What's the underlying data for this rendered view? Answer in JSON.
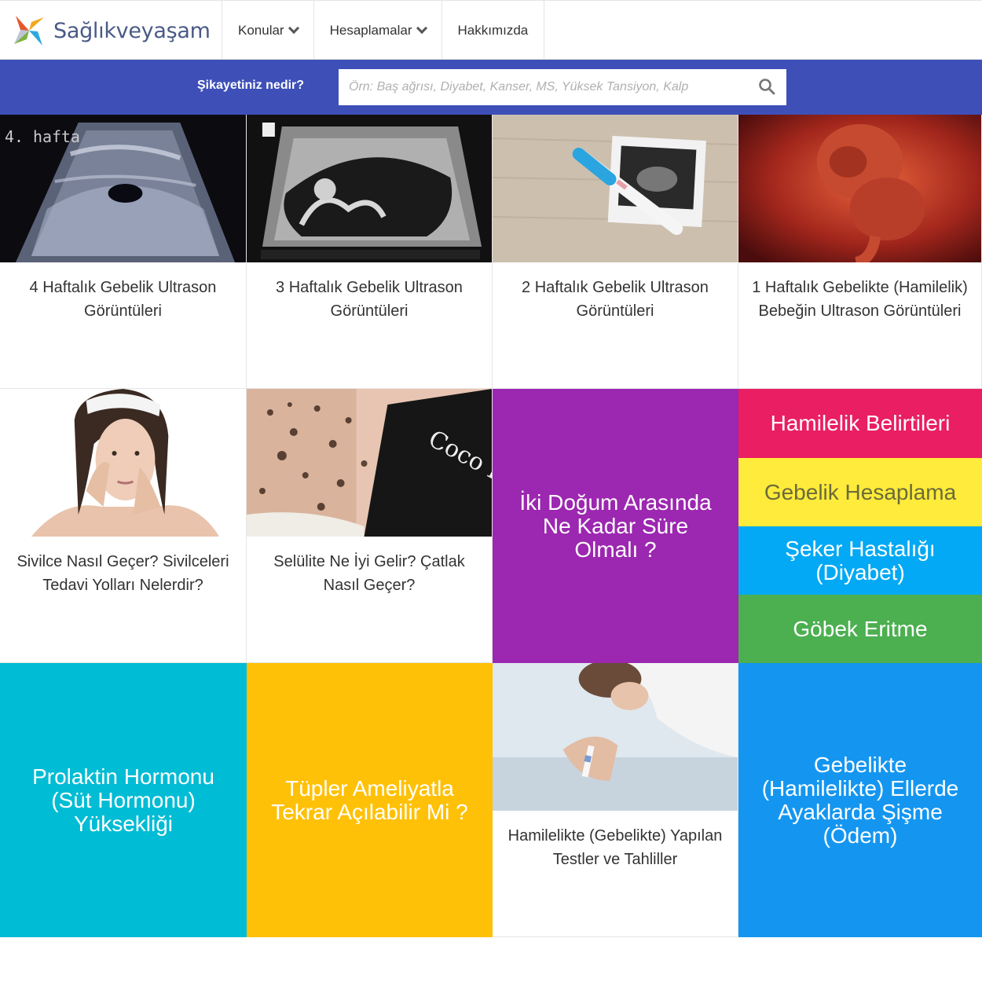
{
  "header": {
    "logo_text": "Sağlıkveyaşam",
    "nav": [
      {
        "label": "Konular",
        "has_dropdown": true
      },
      {
        "label": "Hesaplamalar",
        "has_dropdown": true
      },
      {
        "label": "Hakkımızda",
        "has_dropdown": false
      }
    ]
  },
  "search": {
    "label": "Şikayetiniz nedir?",
    "placeholder": "Örn: Baş ağrısı, Diyabet, Kanser, MS, Yüksek Tansiyon, Kalp",
    "value": "",
    "icon": "search-icon"
  },
  "cards": [
    {
      "title": "4 Haftalık Gebelik Ultrason Görüntüleri",
      "image_text": "4. hafta",
      "image": "ultrasound-week4"
    },
    {
      "title": "3 Haftalık Gebelik Ultrason Görüntüleri",
      "image": "ultrasound-week3"
    },
    {
      "title": "2 Haftalık Gebelik Ultrason Görüntüleri",
      "image": "pregnancy-test-photo"
    },
    {
      "title": "1 Haftalık Gebelikte (Hamilelik) Bebeğin Ultrason Görüntüleri",
      "image": "embryo"
    },
    {
      "title": "Sivilce Nasıl Geçer? Sivilceleri Tedavi Yolları Nelerdir?",
      "image": "woman-acne"
    },
    {
      "title": "Selülite Ne İyi Gelir? Çatlak Nasıl Geçer?",
      "image": "coffee-scrub",
      "image_text": "Coco B Coffee"
    },
    {
      "title": "Hamilelikte (Gebelikte) Yapılan Testler ve Tahliller",
      "image": "woman-pregnancy-test"
    }
  ],
  "tiles": [
    {
      "title": "İki Doğum Arasında Ne Kadar Süre Olmalı ?",
      "color": "#9c27b0"
    },
    {
      "title": "Hamilelik Belirtileri",
      "color": "#e91e63"
    },
    {
      "title": "Gebelik Hesaplama",
      "color": "#ffeb3b"
    },
    {
      "title": "Şeker Hastalığı (Diyabet)",
      "color": "#03a9f4"
    },
    {
      "title": "Göbek Eritme",
      "color": "#4caf50"
    },
    {
      "title": "Prolaktin Hormonu (Süt Hormonu) Yüksekliği",
      "color": "#00bcd4"
    },
    {
      "title": "Tüpler Ameliyatla Tekrar Açılabilir Mi ?",
      "color": "#ffc107"
    },
    {
      "title": "Gebelikte (Hamilelikte) Ellerde Ayaklarda Şişme (Ödem)",
      "color": "#1496f0"
    }
  ],
  "colors": {
    "brand_blue": "#3e4fb8",
    "logo_text": "#4a5a86"
  }
}
